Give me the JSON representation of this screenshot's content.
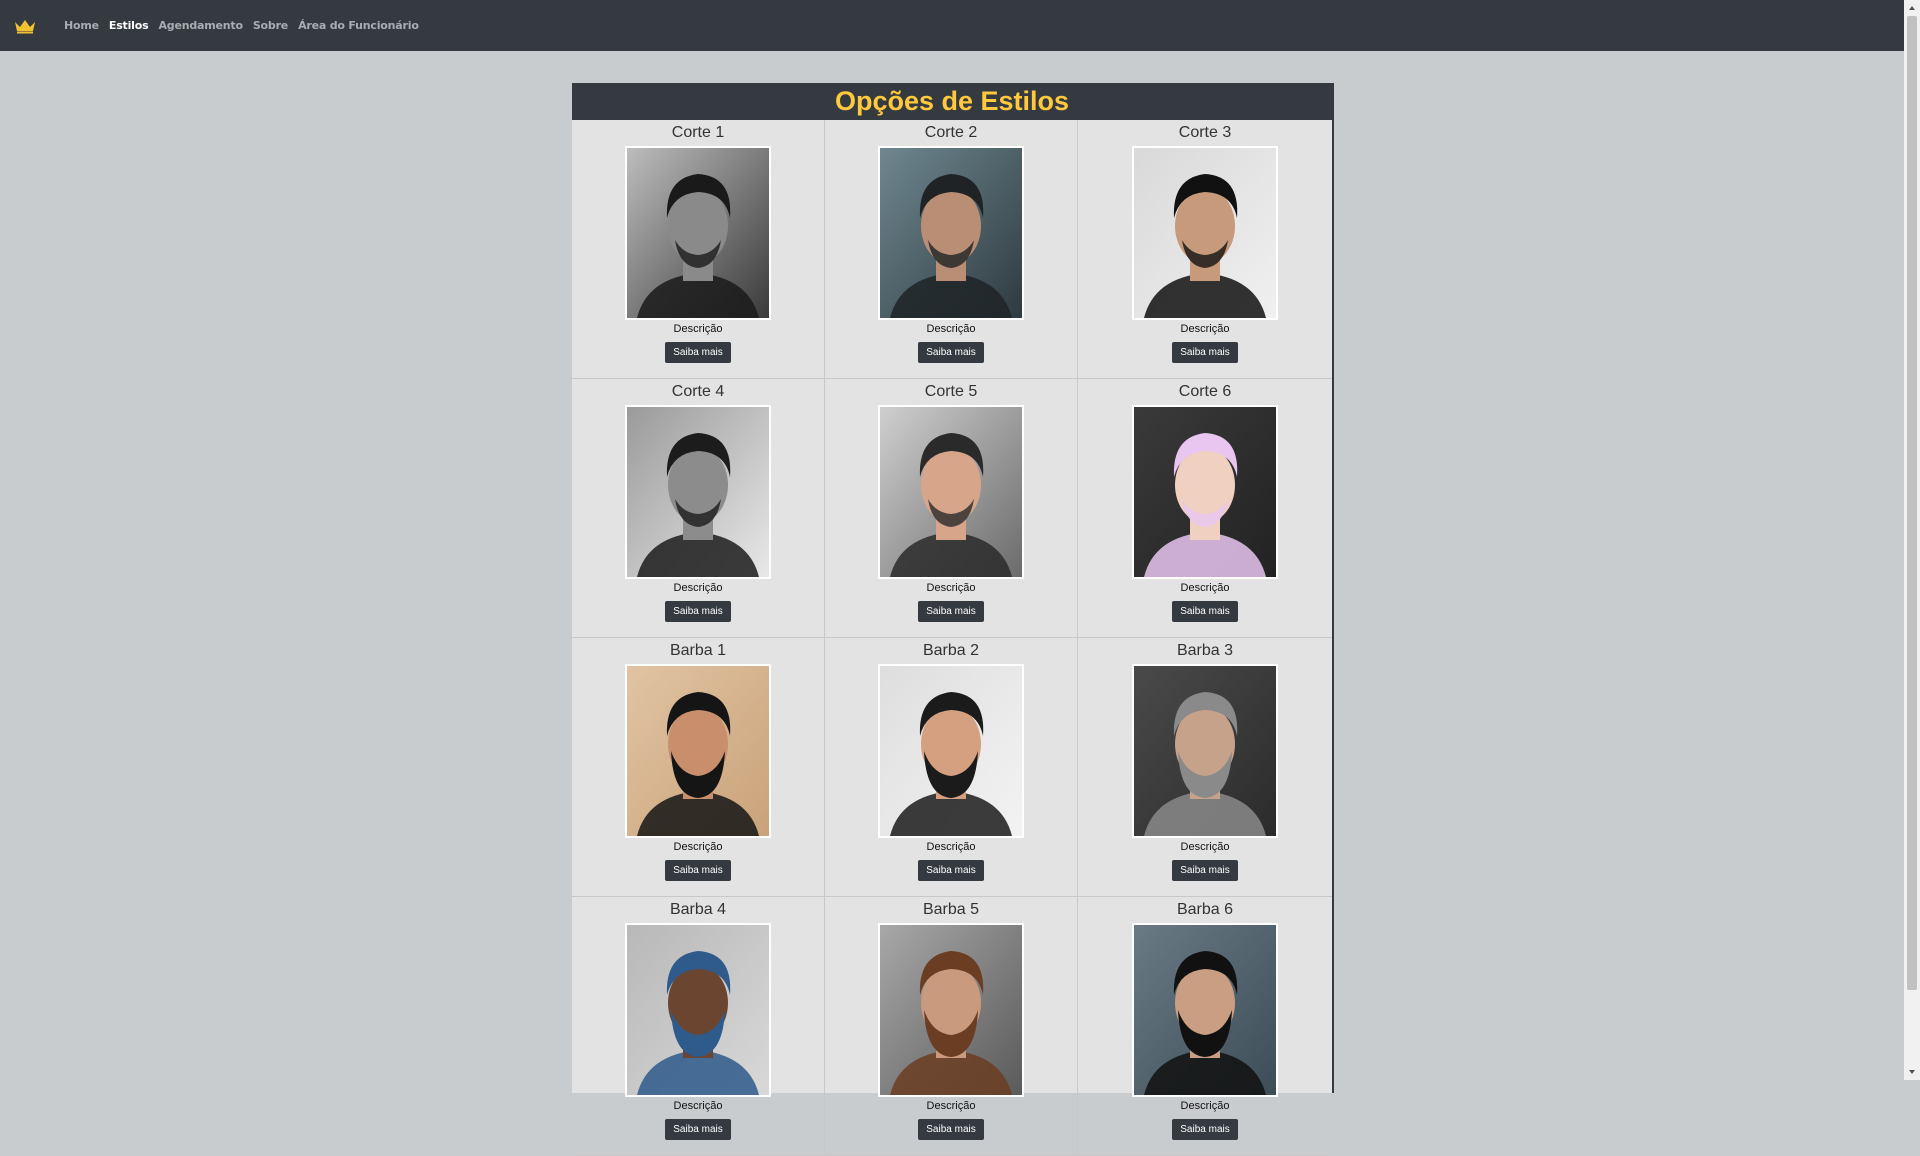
{
  "nav": {
    "brand_icon": "crown-icon",
    "links": [
      "Home",
      "Estilos",
      "Agendamento",
      "Sobre",
      "Área do Funcionário"
    ],
    "active": "Estilos"
  },
  "page": {
    "title": "Opções de Estilos"
  },
  "styles": [
    {
      "name": "Corte 1",
      "description": "Descrição",
      "button": "Saiba mais"
    },
    {
      "name": "Corte 2",
      "description": "Descrição",
      "button": "Saiba mais"
    },
    {
      "name": "Corte 3",
      "description": "Descrição",
      "button": "Saiba mais"
    },
    {
      "name": "Corte 4",
      "description": "Descrição",
      "button": "Saiba mais"
    },
    {
      "name": "Corte 5",
      "description": "Descrição",
      "button": "Saiba mais"
    },
    {
      "name": "Corte 6",
      "description": "Descrição",
      "button": "Saiba mais"
    },
    {
      "name": "Barba 1",
      "description": "Descrição",
      "button": "Saiba mais"
    },
    {
      "name": "Barba 2",
      "description": "Descrição",
      "button": "Saiba mais"
    },
    {
      "name": "Barba 3",
      "description": "Descrição",
      "button": "Saiba mais"
    },
    {
      "name": "Barba 4",
      "description": "Descrição",
      "button": "Saiba mais"
    },
    {
      "name": "Barba 5",
      "description": "Descrição",
      "button": "Saiba mais"
    },
    {
      "name": "Barba 6",
      "description": "Descrição",
      "button": "Saiba mais"
    }
  ],
  "colors": {
    "navbar": "#343a40",
    "accent": "#ffc83d",
    "background": "#c9cccf"
  }
}
